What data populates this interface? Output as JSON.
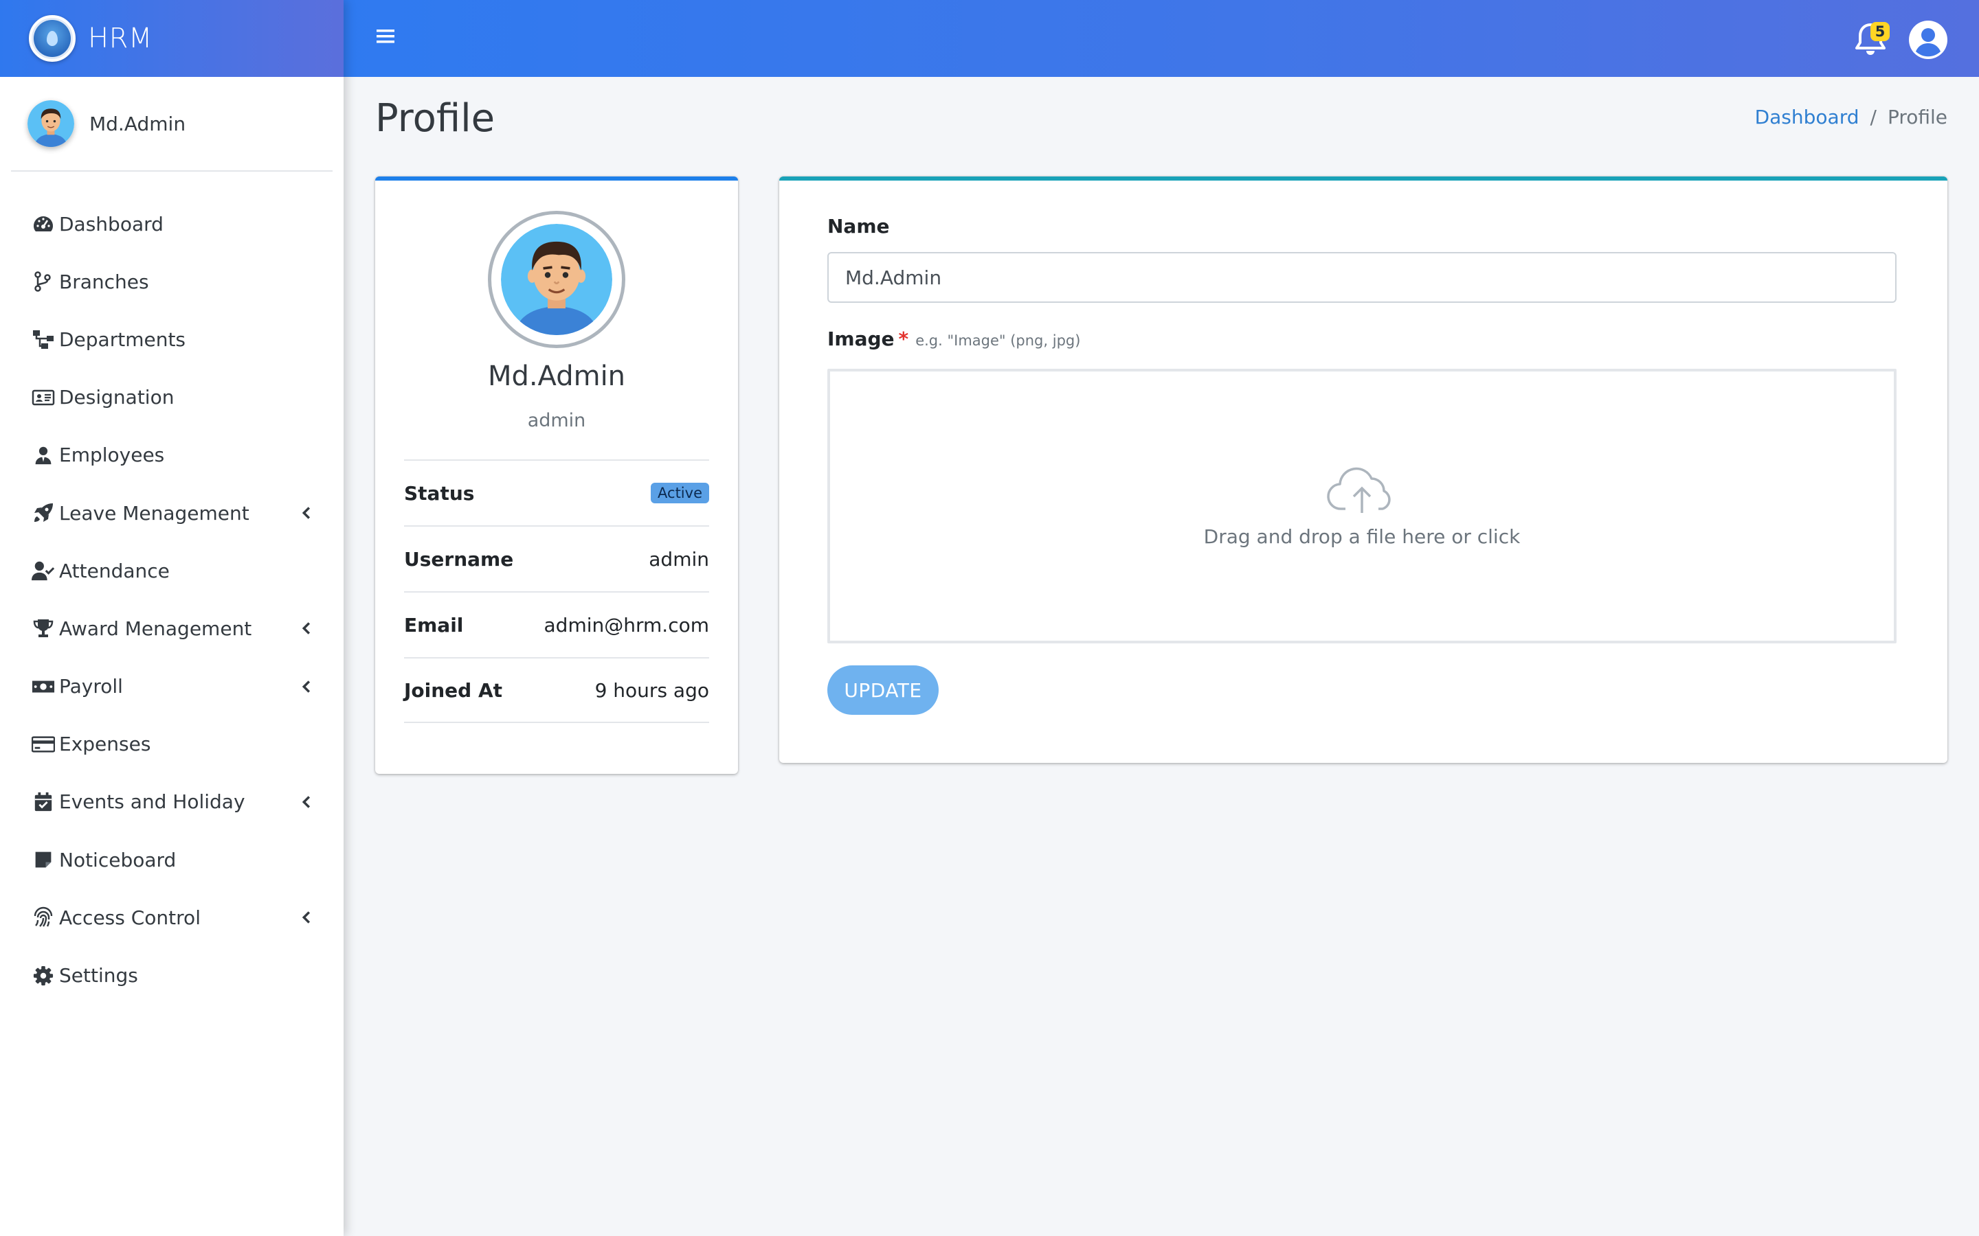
{
  "app": {
    "brand": "HRM"
  },
  "sidebar": {
    "user_name": "Md.Admin",
    "items": [
      {
        "label": "Dashboard",
        "icon": "gauge-icon",
        "has_submenu": false
      },
      {
        "label": "Branches",
        "icon": "code-branch-icon",
        "has_submenu": false
      },
      {
        "label": "Departments",
        "icon": "sitemap-icon",
        "has_submenu": false
      },
      {
        "label": "Designation",
        "icon": "id-card-icon",
        "has_submenu": false
      },
      {
        "label": "Employees",
        "icon": "user-tie-icon",
        "has_submenu": false
      },
      {
        "label": "Leave Menagement",
        "icon": "rocket-icon",
        "has_submenu": true
      },
      {
        "label": "Attendance",
        "icon": "user-check-icon",
        "has_submenu": false
      },
      {
        "label": "Award Menagement",
        "icon": "trophy-icon",
        "has_submenu": true
      },
      {
        "label": "Payroll",
        "icon": "money-bill-icon",
        "has_submenu": true
      },
      {
        "label": "Expenses",
        "icon": "credit-card-icon",
        "has_submenu": false
      },
      {
        "label": "Events and Holiday",
        "icon": "calendar-check-icon",
        "has_submenu": true
      },
      {
        "label": "Noticeboard",
        "icon": "sticky-note-icon",
        "has_submenu": false
      },
      {
        "label": "Access Control",
        "icon": "fingerprint-icon",
        "has_submenu": true
      },
      {
        "label": "Settings",
        "icon": "gear-icon",
        "has_submenu": false
      }
    ]
  },
  "header": {
    "notification_count": "5"
  },
  "page": {
    "title": "Profile",
    "breadcrumb": {
      "home": "Dashboard",
      "separator": "/",
      "current": "Profile"
    }
  },
  "profile": {
    "name": "Md.Admin",
    "role": "admin",
    "rows": [
      {
        "label": "Status",
        "value": "Active"
      },
      {
        "label": "Username",
        "value": "admin"
      },
      {
        "label": "Email",
        "value": "admin@hrm.com"
      },
      {
        "label": "Joined At",
        "value": "9 hours ago"
      }
    ]
  },
  "form": {
    "name_label": "Name",
    "name_value": "Md.Admin",
    "image_label": "Image",
    "image_required_mark": "*",
    "image_hint": "e.g. \"Image\" (png, jpg)",
    "dropzone_text": "Drag and drop a file here or click",
    "update_label": "UPDATE"
  },
  "colors": {
    "header_gradient_start": "#2f7af0",
    "header_gradient_end": "#5470df",
    "profile_card_accent": "#1e80ea",
    "form_card_accent": "#19a2b8",
    "status_badge": "#5aa0e6",
    "update_button": "#6fb2ef",
    "link": "#2f7fd1",
    "notification_badge": "#ffd525"
  }
}
